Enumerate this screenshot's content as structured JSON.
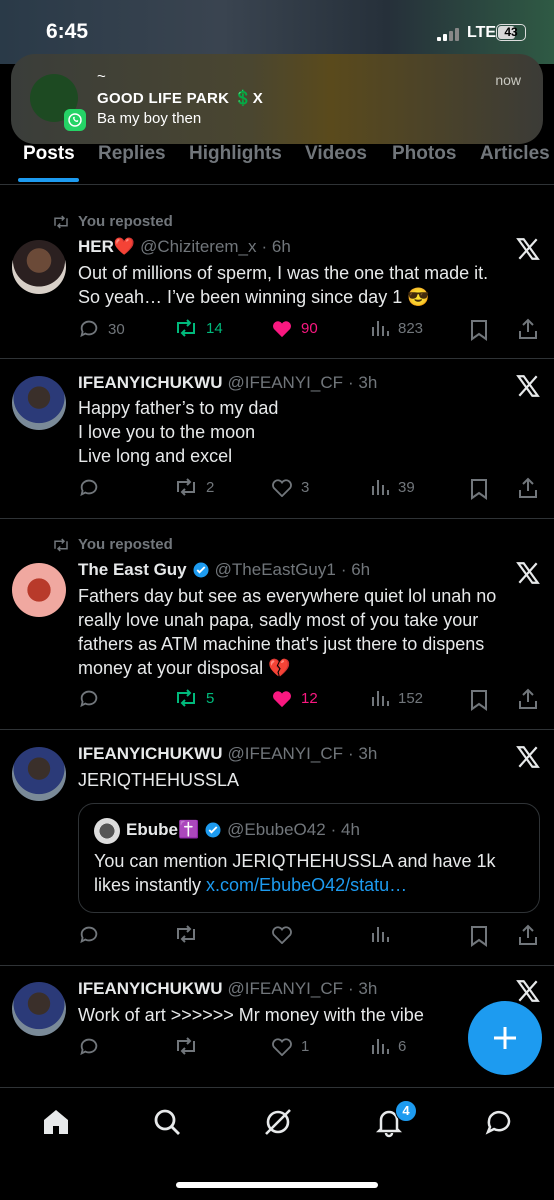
{
  "status_bar": {
    "time": "6:45",
    "network": "LTE",
    "battery": "43"
  },
  "notification": {
    "sender_line": "~",
    "title": "GOOD LIFE PARK 💲X",
    "message": "Ba my boy then",
    "time": "now",
    "app_icon": "whatsapp-icon"
  },
  "tabs": [
    {
      "label": "Posts",
      "active": true
    },
    {
      "label": "Replies"
    },
    {
      "label": "Highlights"
    },
    {
      "label": "Videos"
    },
    {
      "label": "Photos"
    },
    {
      "label": "Articles"
    }
  ],
  "posts": [
    {
      "reposted": "You reposted",
      "name": "HER❤️",
      "handle": "@Chiziterem_x",
      "time": "· 6h",
      "lines": [
        "Out of millions of sperm, I was the one that made it.",
        "So yeah… I’ve been winning since day 1 😎"
      ],
      "replies": "30",
      "reposts": "14",
      "likes": "90",
      "views": "823"
    },
    {
      "name": "IFEANYICHUKWU",
      "handle": "@IFEANYI_CF",
      "time": "· 3h",
      "lines": [
        "Happy father’s to my dad",
        "I love you to the moon",
        "Live long and excel"
      ],
      "replies": "",
      "reposts": "2",
      "likes": "3",
      "views": "39"
    },
    {
      "reposted": "You reposted",
      "name": "The East Guy",
      "handle": "@TheEastGuy1",
      "time": "· 6h",
      "lines": [
        "Fathers day but see as everywhere quiet lol unah no",
        "really love unah papa, sadly most of you take your",
        "fathers as ATM machine that's just there to dispens",
        "money at your disposal 💔"
      ],
      "replies": "",
      "reposts": "5",
      "likes": "12",
      "views": "152"
    },
    {
      "name": "IFEANYICHUKWU",
      "handle": "@IFEANYI_CF",
      "time": "· 3h",
      "lines": [
        "JERIQTHEHUSSLA"
      ],
      "quote": {
        "name": "Ebube✝️",
        "handle": "@EbubeO42",
        "time": "· 4h",
        "line1": "You can mention JERIQTHEHUSSLA and have 1k",
        "line2_text": "likes instantly ",
        "line2_link": "x.com/EbubeO42/statu…"
      }
    },
    {
      "name": "IFEANYICHUKWU",
      "handle": "@IFEANYI_CF",
      "time": "· 3h",
      "lines": [
        "Work of art >>>>>> Mr money with the vibe"
      ],
      "likes": "1",
      "views": "6"
    }
  ],
  "nav": {
    "notifications_badge": "4"
  },
  "colors": {
    "accent": "#1d9bf0",
    "like": "#f91880",
    "repost": "#00ba7c",
    "muted": "#71767b"
  }
}
